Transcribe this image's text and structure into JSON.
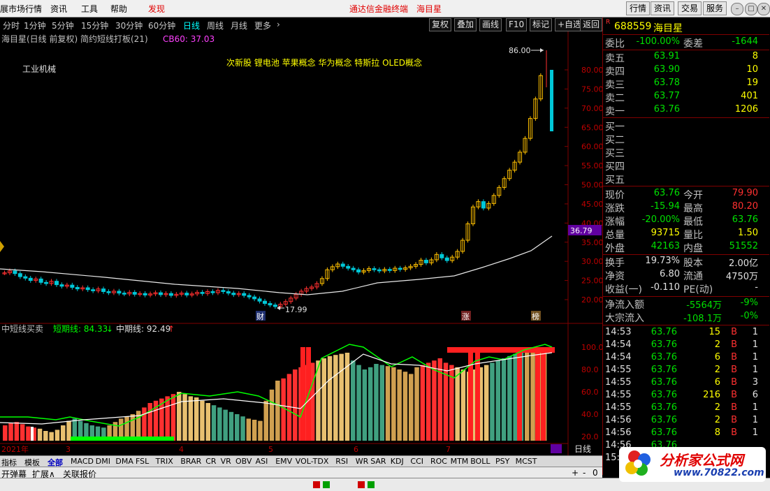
{
  "menu": {
    "items": [
      "展市场行情",
      "资讯",
      "工具",
      "帮助",
      "发现"
    ],
    "center_title": "通达信金融终端",
    "center_stock": "海目星",
    "right_buttons": [
      "行情",
      "资讯",
      "交易",
      "服务"
    ]
  },
  "period_tabs": [
    "分时",
    "1分钟",
    "5分钟",
    "15分钟",
    "30分钟",
    "60分钟",
    "日线",
    "周线",
    "月线",
    "更多"
  ],
  "active_period": "日线",
  "toolbar_buttons": [
    "复权",
    "叠加",
    "画线",
    "F10",
    "标记",
    "+自选",
    "返回"
  ],
  "chart_header": {
    "title": "海目星(日线 前复权) 简约短线打板(21)",
    "cb_label": "CB60: 37.03",
    "industry": "工业机械",
    "concepts": "次新股 锂电池 苹果概念 华为概念 特斯拉 OLED概念",
    "high_label": "86.00",
    "low_label": "17.99",
    "current_price_tag": "36.79",
    "event_labels": [
      "财",
      "涨",
      "榜"
    ]
  },
  "y_axis_main": [
    "80.00",
    "75.00",
    "70.00",
    "65.00",
    "60.00",
    "55.00",
    "50.00",
    "45.00",
    "40.00",
    "35.00",
    "30.00",
    "25.00",
    "20.00"
  ],
  "indicator_header": {
    "name": "中短线买卖",
    "short_label": "短期线: 84.33",
    "mid_label": "中期线: 92.49"
  },
  "y_axis_sub": [
    "100.0",
    "80.0",
    "60.0",
    "40.0",
    "20.0"
  ],
  "x_axis": {
    "year": "2021年",
    "months": [
      "3",
      "4",
      "5",
      "6",
      "7"
    ],
    "period_label": "日线"
  },
  "bottom_tabs": [
    "指标",
    "模板",
    "全部",
    "MACD",
    "DMI",
    "DMA",
    "FSL",
    "TRIX",
    "BRAR",
    "CR",
    "VR",
    "OBV",
    "ASI",
    "EMV",
    "VOL-TDX",
    "RSI",
    "WR",
    "SAR",
    "KDJ",
    "CCI",
    "ROC",
    "MTM",
    "BOLL",
    "PSY",
    "MCST"
  ],
  "bottom_bar2": [
    "开弹幕",
    "扩展∧",
    "关联报价"
  ],
  "stock": {
    "code": "688559",
    "name": "海目星",
    "weibi_label": "委比",
    "weibi": "-100.00%",
    "weicha_label": "委差",
    "weicha": "-1644",
    "asks": [
      {
        "label": "卖五",
        "price": "63.91",
        "vol": "8"
      },
      {
        "label": "卖四",
        "price": "63.90",
        "vol": "10"
      },
      {
        "label": "卖三",
        "price": "63.78",
        "vol": "19"
      },
      {
        "label": "卖二",
        "price": "63.77",
        "vol": "401"
      },
      {
        "label": "卖一",
        "price": "63.76",
        "vol": "1206"
      }
    ],
    "bids": [
      "买一",
      "买二",
      "买三",
      "买四",
      "买五"
    ],
    "quote": [
      {
        "l1": "现价",
        "v1": "63.76",
        "l2": "今开",
        "v2": "79.90"
      },
      {
        "l1": "涨跌",
        "v1": "-15.94",
        "l2": "最高",
        "v2": "80.20"
      },
      {
        "l1": "涨幅",
        "v1": "-20.00%",
        "l2": "最低",
        "v2": "63.76"
      },
      {
        "l1": "总量",
        "v1": "93715",
        "l2": "量比",
        "v2": "1.50"
      },
      {
        "l1": "外盘",
        "v1": "42163",
        "l2": "内盘",
        "v2": "51552"
      }
    ],
    "fundamentals": [
      {
        "l1": "换手",
        "v1": "19.73%",
        "l2": "股本",
        "v2": "2.00亿"
      },
      {
        "l1": "净资",
        "v1": "6.80",
        "l2": "流通",
        "v2": "4750万"
      },
      {
        "l1": "收益(一)",
        "v1": "-0.110",
        "l2": "PE(动)",
        "v2": "-"
      }
    ],
    "flows": [
      {
        "l": "净流入额",
        "v1": "-5564万",
        "v2": "-9%"
      },
      {
        "l": "大宗流入",
        "v1": "-108.1万",
        "v2": "-0%"
      }
    ],
    "ticks": [
      {
        "t": "14:53",
        "p": "63.76",
        "v": "15",
        "s": "B",
        "n": "1"
      },
      {
        "t": "14:54",
        "p": "63.76",
        "v": "2",
        "s": "B",
        "n": "1"
      },
      {
        "t": "14:54",
        "p": "63.76",
        "v": "6",
        "s": "B",
        "n": "1"
      },
      {
        "t": "14:55",
        "p": "63.76",
        "v": "2",
        "s": "B",
        "n": "1"
      },
      {
        "t": "14:55",
        "p": "63.76",
        "v": "6",
        "s": "B",
        "n": "3"
      },
      {
        "t": "14:55",
        "p": "63.76",
        "v": "216",
        "s": "B",
        "n": "6"
      },
      {
        "t": "14:55",
        "p": "63.76",
        "v": "2",
        "s": "B",
        "n": "1"
      },
      {
        "t": "14:56",
        "p": "63.76",
        "v": "2",
        "s": "B",
        "n": "1"
      },
      {
        "t": "14:56",
        "p": "63.76",
        "v": "8",
        "s": "B",
        "n": "1"
      },
      {
        "t": "14:56",
        "p": "63.76",
        "v": "",
        "s": "",
        "n": ""
      },
      {
        "t": "15:00",
        "p": "",
        "v": "",
        "s": "",
        "n": ""
      }
    ]
  },
  "watermark": {
    "text": "分析家公式网",
    "url": "www.70822.com"
  },
  "colors": {
    "up": "#ff3030",
    "down": "#00c0c0",
    "yellow": "#ffd700",
    "green_line": "#00ff00"
  }
}
